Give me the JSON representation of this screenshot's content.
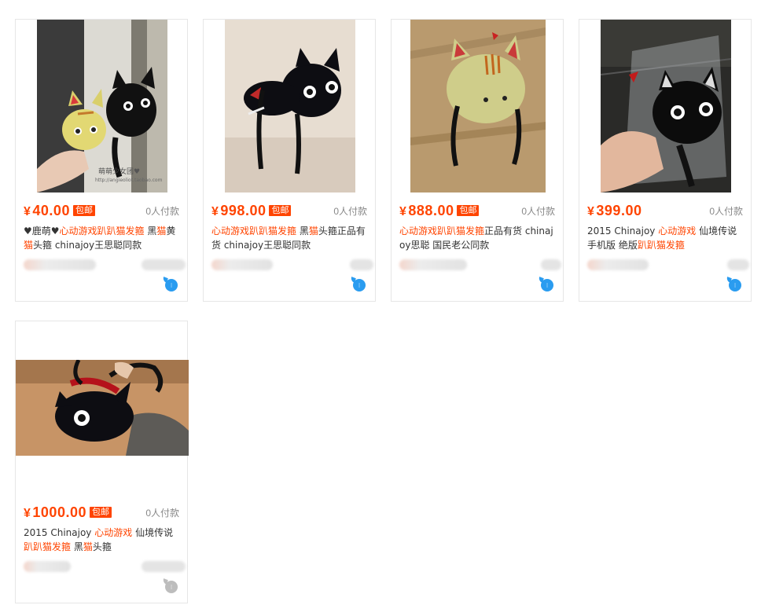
{
  "products": [
    {
      "price_symbol": "¥",
      "price": "40.00",
      "badge": "包邮",
      "paid_count": "0人付款",
      "title_parts": [
        {
          "t": "♥鹿萌♥",
          "hl": false
        },
        {
          "t": "心动游戏",
          "hl": true
        },
        {
          "t": "趴趴猫发箍",
          "hl": true
        },
        {
          "t": " 黑",
          "hl": false
        },
        {
          "t": "猫",
          "hl": true
        },
        {
          "t": "黄",
          "hl": false
        },
        {
          "t": "猫",
          "hl": true
        },
        {
          "t": "头箍 chinajoy王思聪同款",
          "hl": false
        }
      ],
      "watermark": "萌萌少女团♥",
      "watermark_url": "http://angieoliot.taobao.com",
      "ww_icon": "wangwang-chat-icon"
    },
    {
      "price_symbol": "¥",
      "price": "998.00",
      "badge": "包邮",
      "paid_count": "0人付款",
      "title_parts": [
        {
          "t": "心动游戏",
          "hl": true
        },
        {
          "t": "趴趴猫发箍",
          "hl": true
        },
        {
          "t": " 黑",
          "hl": false
        },
        {
          "t": "猫",
          "hl": true
        },
        {
          "t": "头箍正品有货 chinajoy王思聪同款",
          "hl": false
        }
      ],
      "ww_icon": "wangwang-chat-icon"
    },
    {
      "price_symbol": "¥",
      "price": "888.00",
      "badge": "包邮",
      "paid_count": "0人付款",
      "title_parts": [
        {
          "t": "心动游戏",
          "hl": true
        },
        {
          "t": "趴趴猫发箍",
          "hl": true
        },
        {
          "t": "正品有货 chinajoy思聪 国民老公同款",
          "hl": false
        }
      ],
      "ww_icon": "wangwang-chat-icon"
    },
    {
      "price_symbol": "¥",
      "price": "399.00",
      "badge": "",
      "paid_count": "0人付款",
      "title_parts": [
        {
          "t": "2015 Chinajoy ",
          "hl": false
        },
        {
          "t": "心动游戏",
          "hl": true
        },
        {
          "t": " 仙境传说手机版 绝版",
          "hl": false
        },
        {
          "t": "趴趴猫发箍",
          "hl": true
        }
      ],
      "ww_icon": "wangwang-chat-icon"
    },
    {
      "price_symbol": "¥",
      "price": "1000.00",
      "badge": "包邮",
      "paid_count": "0人付款",
      "title_parts": [
        {
          "t": "2015 Chinajoy ",
          "hl": false
        },
        {
          "t": "心动游戏",
          "hl": true
        },
        {
          "t": " 仙境传说 ",
          "hl": false
        },
        {
          "t": "趴趴猫发箍",
          "hl": true
        },
        {
          "t": " 黑",
          "hl": false
        },
        {
          "t": "猫",
          "hl": true
        },
        {
          "t": "头箍",
          "hl": false
        }
      ],
      "ww_icon": "wangwang-offline-icon"
    }
  ],
  "colors": {
    "accent": "#ff4400",
    "border": "#e6e6e6",
    "ww_online": "#2a9cf0",
    "ww_offline": "#bdbdbd"
  }
}
